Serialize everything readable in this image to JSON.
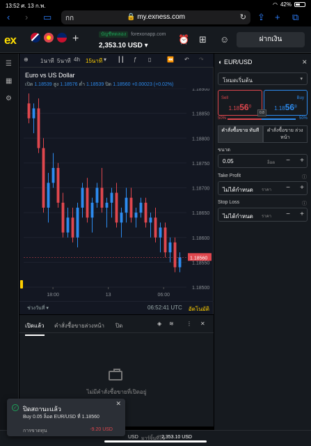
{
  "status": {
    "time": "13:52",
    "date": "ศ. 13 ก.พ.",
    "battery": "42%"
  },
  "browser": {
    "aa": "กก",
    "url": "my.exness.com"
  },
  "header": {
    "logo": "ex",
    "account_badge": "บัญชีทดลอง",
    "server": "forexonapp.com",
    "balance": "2,353.10 USD",
    "deposit_label": "ฝากเงิน"
  },
  "chart_toolbar": {
    "tf1": "1นาที",
    "tf2": "5นาที",
    "tf3": "4h",
    "tf4": "15นาที"
  },
  "chart_data": {
    "type": "candlestick",
    "title": "Euro vs US Dollar",
    "ohlc": {
      "open_label": "เปิด",
      "open": "1.18539",
      "high_label": "สูง",
      "high": "1.18576",
      "low_label": "ต่ำ",
      "low": "1.18539",
      "close_label": "ปิด",
      "close": "1.18560",
      "change": "+0.00023 (+0.02%)"
    },
    "y_ticks": [
      "1.18900",
      "1.18850",
      "1.18800",
      "1.18750",
      "1.18700",
      "1.18650",
      "1.18600",
      "1.18550",
      "1.18500"
    ],
    "ylim": [
      1.185,
      1.189
    ],
    "x_ticks": [
      "18:00",
      "13",
      "06:00"
    ],
    "current_price": "1.18560",
    "candles": [
      [
        1.1887,
        1.1889,
        1.1883,
        1.1884
      ],
      [
        1.1884,
        1.1887,
        1.1881,
        1.1886
      ],
      [
        1.1886,
        1.1888,
        1.1877,
        1.1878
      ],
      [
        1.1878,
        1.188,
        1.1865,
        1.1866
      ],
      [
        1.1866,
        1.1873,
        1.1863,
        1.1871
      ],
      [
        1.1871,
        1.1877,
        1.187,
        1.1874
      ],
      [
        1.1874,
        1.1875,
        1.1866,
        1.1867
      ],
      [
        1.1867,
        1.1869,
        1.186,
        1.1861
      ],
      [
        1.1861,
        1.1866,
        1.186,
        1.1864
      ],
      [
        1.1864,
        1.1866,
        1.1859,
        1.186
      ],
      [
        1.186,
        1.1867,
        1.1858,
        1.1866
      ],
      [
        1.1866,
        1.1871,
        1.1864,
        1.187
      ],
      [
        1.187,
        1.1872,
        1.1863,
        1.1864
      ],
      [
        1.1864,
        1.1868,
        1.1861,
        1.1867
      ],
      [
        1.1867,
        1.1871,
        1.1866,
        1.187
      ],
      [
        1.187,
        1.1874,
        1.1865,
        1.1866
      ],
      [
        1.1866,
        1.1868,
        1.1862,
        1.1867
      ],
      [
        1.1867,
        1.187,
        1.1864,
        1.1869
      ],
      [
        1.1869,
        1.1871,
        1.1862,
        1.1863
      ],
      [
        1.1863,
        1.1866,
        1.186,
        1.1865
      ],
      [
        1.1865,
        1.187,
        1.1863,
        1.1868
      ],
      [
        1.1868,
        1.187,
        1.1863,
        1.1864
      ],
      [
        1.1864,
        1.1866,
        1.1862,
        1.1865
      ],
      [
        1.1865,
        1.1868,
        1.1864,
        1.1867
      ],
      [
        1.1867,
        1.1868,
        1.1862,
        1.1863
      ],
      [
        1.1863,
        1.1865,
        1.186,
        1.1864
      ],
      [
        1.1864,
        1.1866,
        1.1859,
        1.186
      ],
      [
        1.186,
        1.1863,
        1.1857,
        1.1862
      ],
      [
        1.1862,
        1.1863,
        1.1856,
        1.1857
      ],
      [
        1.1857,
        1.186,
        1.1855,
        1.1859
      ],
      [
        1.1859,
        1.186,
        1.1853,
        1.1854
      ],
      [
        1.1854,
        1.1857,
        1.1853,
        1.1856
      ]
    ]
  },
  "chart_footer": {
    "range_label": "ช่วงวันที่",
    "clock": "06:52:41 UTC",
    "auto": "อัตโนมัติ"
  },
  "order": {
    "symbol": "EUR/USD",
    "mode": "โหมดเริ่มต้น",
    "sell_label": "Sell",
    "sell_prefix": "1.18",
    "sell_big": "56",
    "sell_sup": "0",
    "buy_label": "Buy",
    "buy_prefix": "1.18",
    "buy_big": "56",
    "buy_sup": "8",
    "spread": "0.8",
    "sentiment_sell": "50%",
    "sentiment_buy": "50%",
    "sentiment_sell_fraction": 0.5,
    "tab_market": "คำสั่งซื้อขาย ทันที",
    "tab_pending": "คำสั่งซื้อขาย ล่วงหน้า",
    "volume_label": "ขนาด",
    "volume_value": "0.05",
    "volume_unit": "ล็อต",
    "tp_label": "Take Profit",
    "tp_value": "ไม่ได้กำหนด",
    "tp_unit": "ราคา",
    "sl_label": "Stop Loss",
    "sl_value": "ไม่ได้กำหนด",
    "sl_unit": "ราคา"
  },
  "positions": {
    "tab_open": "เปิดแล้ว",
    "tab_pending": "คำสั่งซื้อขายล่วงหน้า",
    "tab_closed": "ปิด",
    "empty_text": "ไม่มีคำสั่งซื้อขายที่เปิดอยู่"
  },
  "footer": {
    "currency": "USD",
    "margin_label": "มาร์จิ้นที่ใช้",
    "balance": "2,353.10 USD"
  },
  "toast": {
    "title": "ปิดสถานะแล้ว",
    "message": "Buy 0.05 ล็อต EUR/USD ที่ 1.18560",
    "pl_label": "การขาดทุน",
    "pl_value": "-9.20 USD"
  },
  "colors": {
    "bull": "#2d8cf0",
    "bear": "#e0474e",
    "accent": "#ffcf00"
  }
}
